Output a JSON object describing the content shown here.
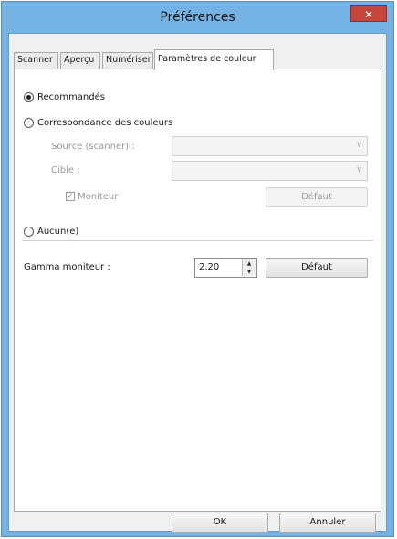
{
  "window": {
    "title": "Préférences",
    "close_symbol": "✕"
  },
  "tabs": [
    {
      "label": "Scanner"
    },
    {
      "label": "Aperçu"
    },
    {
      "label": "Numériser"
    },
    {
      "label": "Paramètres de couleur",
      "active": true
    }
  ],
  "color": {
    "recommended_label": "Recommandés",
    "matching_label": "Correspondance des couleurs",
    "source_label": "Source (scanner) :",
    "target_label": "Cible :",
    "monitor_checkbox_label": "Moniteur",
    "monitor_checked": true,
    "default_disabled_label": "Défaut",
    "none_label": "Aucun(e)",
    "selected": "Recommandés"
  },
  "gamma": {
    "label": "Gamma moniteur :",
    "value": "2,20",
    "default_label": "Défaut"
  },
  "footer": {
    "ok_label": "OK",
    "cancel_label": "Annuler"
  },
  "icons": {
    "dropdown": "chevron-down-icon",
    "checkmark": "checkmark-icon",
    "close": "close-icon"
  }
}
